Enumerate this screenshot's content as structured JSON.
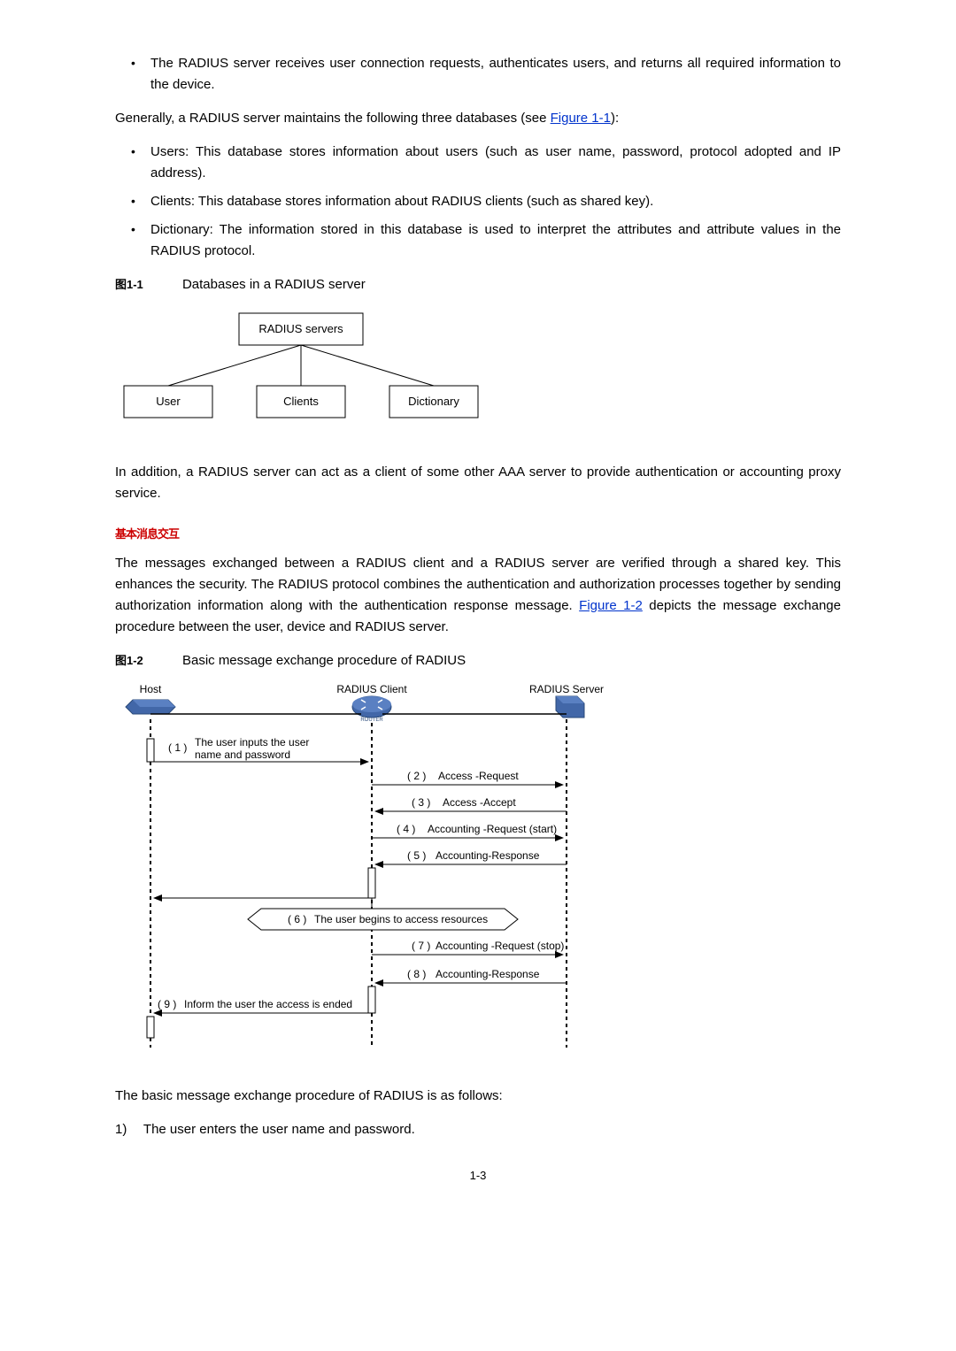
{
  "bullets1": {
    "b1": "The RADIUS server receives user connection requests, authenticates users, and returns all required information to the device."
  },
  "para1_a": "Generally, a RADIUS server maintains the following three databases (see ",
  "para1_link": "Figure 1-1",
  "para1_b": "):",
  "bullets2": {
    "b1": "Users: This database stores information about users (such as user name, password, protocol adopted and IP address).",
    "b2": "Clients: This database stores information about RADIUS clients (such as shared key).",
    "b3": "Dictionary: The information stored in this database is used to interpret the attributes and attribute values in the RADIUS protocol."
  },
  "fig1": {
    "num": "图1-1",
    "title": "Databases in a RADIUS server",
    "top": "RADIUS servers",
    "n1": "User",
    "n2": "Clients",
    "n3": "Dictionary"
  },
  "para2": "In addition, a RADIUS server can act as a client of some other AAA server to provide authentication or accounting proxy service.",
  "marker1": "基本消息交互",
  "para3_a": "The messages exchanged between a RADIUS client and a RADIUS server are verified through a shared key. This enhances the security. The RADIUS protocol combines the authentication and authorization processes together by sending authorization information along with the authentication response message. ",
  "para3_link": "Figure 1-2",
  "para3_b": " depicts the message exchange procedure between the user, device and RADIUS server.",
  "fig2": {
    "num": "图1-2",
    "title": "Basic message exchange procedure of RADIUS",
    "host": "Host",
    "client": "RADIUS Client",
    "server": "RADIUS Server",
    "s1_n": "( 1 )",
    "s1_a": "The user inputs the user",
    "s1_b": "name and password",
    "s2_n": "( 2 )",
    "s2": "Access -Request",
    "s3_n": "( 3 )",
    "s3": "Access -Accept",
    "s4_n": "( 4 )",
    "s4": "Accounting -Request (start)",
    "s5_n": "( 5 )",
    "s5": "Accounting-Response",
    "s6_n": "( 6 )",
    "s6": "The user begins to access resources",
    "s7_n": "( 7 )",
    "s7": "Accounting -Request (stop)",
    "s8_n": "( 8 )",
    "s8": "Accounting-Response",
    "s9_n": "( 9 )",
    "s9": "Inform the user the access is ended"
  },
  "para4": "The basic message exchange procedure of RADIUS is as follows:",
  "num1_label": "1)",
  "num1_text": "The user enters the user name and password.",
  "page": "1-3"
}
